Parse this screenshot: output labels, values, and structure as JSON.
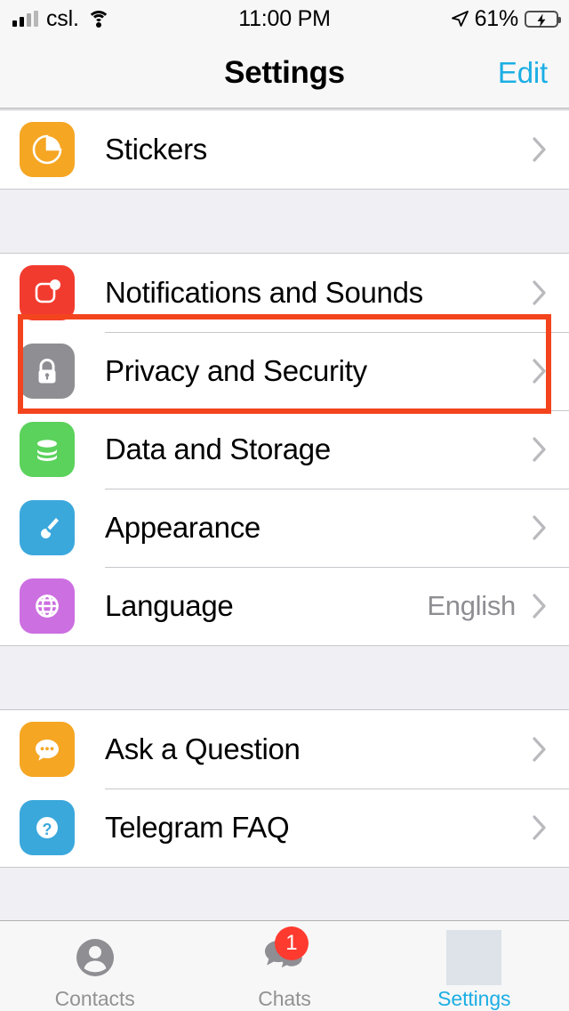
{
  "status_bar": {
    "carrier": "csl.",
    "time": "11:00 PM",
    "battery_percent": "61%",
    "battery_level": 61,
    "charging": true,
    "icons": [
      "signal-bars-icon",
      "wifi-icon",
      "location-arrow-icon",
      "battery-charging-icon"
    ]
  },
  "nav": {
    "title": "Settings",
    "edit_label": "Edit",
    "edit_color": "#1CAEE4"
  },
  "sections": [
    {
      "id": "stickers-section",
      "rows": [
        {
          "label": "Stickers",
          "value": "",
          "icon": "stickers-icon",
          "icon_color": "#F5A623",
          "chevron": true
        }
      ]
    },
    {
      "id": "preferences-section",
      "rows": [
        {
          "label": "Notifications and Sounds",
          "value": "",
          "icon": "notifications-icon",
          "icon_color": "#F23B2F",
          "chevron": true
        },
        {
          "label": "Privacy and Security",
          "value": "",
          "icon": "lock-icon",
          "icon_color": "#8E8E93",
          "chevron": true,
          "highlighted": true
        },
        {
          "label": "Data and Storage",
          "value": "",
          "icon": "database-icon",
          "icon_color": "#5BD25B",
          "chevron": true
        },
        {
          "label": "Appearance",
          "value": "",
          "icon": "paintbrush-icon",
          "icon_color": "#3BA8DC",
          "chevron": true
        },
        {
          "label": "Language",
          "value": "English",
          "icon": "globe-icon",
          "icon_color": "#CC6FE0",
          "chevron": true
        }
      ]
    },
    {
      "id": "help-section",
      "rows": [
        {
          "label": "Ask a Question",
          "value": "",
          "icon": "chat-bubble-icon",
          "icon_color": "#F5A623",
          "chevron": true
        },
        {
          "label": "Telegram FAQ",
          "value": "",
          "icon": "question-mark-icon",
          "icon_color": "#3BA8DC",
          "chevron": true
        }
      ]
    }
  ],
  "highlight": {
    "target": "Privacy and Security",
    "color": "#F4441E"
  },
  "tab_bar": {
    "tabs": [
      {
        "label": "Contacts",
        "icon": "person-icon",
        "active": false,
        "badge": ""
      },
      {
        "label": "Chats",
        "icon": "chats-icon",
        "active": false,
        "badge": "1"
      },
      {
        "label": "Settings",
        "icon": "settings-placeholder-icon",
        "active": true,
        "badge": ""
      }
    ],
    "active_color": "#1CAEE4",
    "inactive_color": "#929292",
    "badge_color": "#FF3B30"
  }
}
